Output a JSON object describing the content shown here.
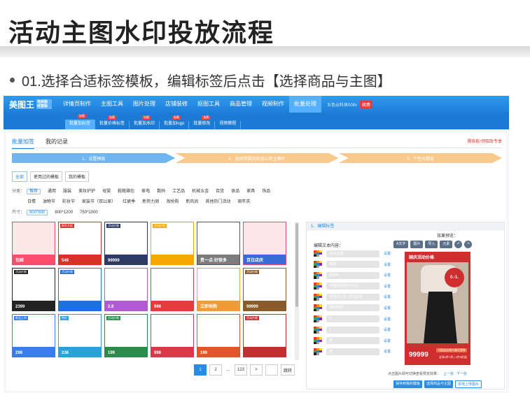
{
  "slide": {
    "title": "活动主图水印投放流程",
    "bullet": "01.选择合适标签模板，编辑标签后点击【选择商品与主图】"
  },
  "app": {
    "logo": "美图王",
    "logo_sub": "电商版 经营版",
    "nav": [
      "详情页制作",
      "主图工具",
      "图片处理",
      "店铺装修",
      "抠图工具",
      "商品管理",
      "视频制作",
      "批量处理"
    ],
    "vip_text": "五色云料体008v",
    "vip_button": "续费",
    "subnav": [
      {
        "label": "批量加标签",
        "tag": "加载"
      },
      {
        "label": "批量价格标签",
        "tag": "加载"
      },
      {
        "label": "批量加水印",
        "tag": "加载"
      },
      {
        "label": "批量加logo",
        "tag": "加载"
      },
      {
        "label": "批量修改",
        "tag": "加载"
      },
      {
        "label": "视频教程",
        "tag": ""
      }
    ]
  },
  "tabs": {
    "t1": "批量加签",
    "t2": "我的记录",
    "promo": "需级能/领取政专享"
  },
  "steps": [
    "1、设置模板",
    "2、选择需要的商品以及主图片",
    "3、个性化精选"
  ],
  "filters": [
    "全部",
    "使用过的模板",
    "我的模板"
  ],
  "cats": {
    "label": "分类：",
    "row1": [
      "推荐",
      "通用",
      "服装",
      "美妆护护",
      "母婴",
      "鞋靴箱包",
      "家电",
      "数码",
      "工艺品",
      "机械五金",
      "百货",
      "食品",
      "家具",
      "饰品"
    ],
    "row2": [
      "日情",
      "油物节",
      "彩妆节",
      "家装节（双11家）",
      "红更季",
      "新势力周",
      "淘抢购",
      "新风尚",
      "其他热门活动",
      "周年庆"
    ],
    "size_label": "尺寸：",
    "sizes": [
      "800*800",
      "800*1200",
      "750*1000"
    ]
  },
  "templates": [
    {
      "top": "",
      "price": "包邮",
      "bg": "#fde6e8",
      "bar": "#ff4d6d",
      "tc": "#e34b6f"
    },
    {
      "top": "新年大促",
      "price": "549",
      "bg": "#fff",
      "bar": "#d9302c",
      "tc": "#d9302c"
    },
    {
      "top": "活动价格",
      "price": "99999",
      "bg": "#fff",
      "bar": "#2b3a67",
      "tc": "#2b3a67"
    },
    {
      "top": "活动价格",
      "price": "",
      "bg": "#fff",
      "bar": "#f7a800",
      "tc": "#f7a800"
    },
    {
      "top": "",
      "price": "贵一点·好很多",
      "bg": "#fff",
      "bar": "#7c7c7c",
      "tc": "#555"
    },
    {
      "top": "",
      "price": "百日店庆",
      "bg": "#fbe5e8",
      "bar": "#3a6bd4",
      "tc": "#e94b6a"
    },
    {
      "top": "活动价格",
      "price": "2399",
      "bg": "#fff",
      "bar": "#222",
      "tc": "#222"
    },
    {
      "top": "活动价格",
      "price": "",
      "bg": "#fff",
      "bar": "#1e6fe0",
      "tc": "#1e6fe0"
    },
    {
      "top": "",
      "price": "2.8",
      "bg": "#fff",
      "bar": "#b25ad4",
      "tc": "#b25ad4"
    },
    {
      "top": "",
      "price": "998",
      "bg": "#fff",
      "bar": "#e43c3c",
      "tc": "#e43c3c"
    },
    {
      "top": "",
      "price": "立即抢购",
      "bg": "#fff",
      "bar": "#f19a3a",
      "tc": "#f19a3a"
    },
    {
      "top": "活动价格",
      "price": "99999",
      "bg": "#fff",
      "bar": "#8a5a2b",
      "tc": "#8a5a2b"
    },
    {
      "top": "新品上市",
      "price": "298",
      "bg": "#fff",
      "bar": "#3a7de8",
      "tc": "#3a7de8"
    },
    {
      "top": "特价",
      "price": "238",
      "bg": "#fff",
      "bar": "#2aa1d8",
      "tc": "#2aa1d8"
    },
    {
      "top": "活动价格",
      "price": "199",
      "bg": "#fff",
      "bar": "#2c8a4a",
      "tc": "#2c8a4a"
    },
    {
      "top": "",
      "price": "998",
      "bg": "#fff",
      "bar": "#d83a4a",
      "tc": "#d83a4a"
    },
    {
      "top": "",
      "price": "199",
      "bg": "#fff",
      "bar": "#e0552a",
      "tc": "#e0552a"
    },
    {
      "top": "活动价格",
      "price": "",
      "bg": "#fff",
      "bar": "#c23030",
      "tc": "#c23030"
    }
  ],
  "pager": [
    "1",
    "2",
    "...",
    "123",
    ">",
    "",
    "跳转"
  ],
  "editor": {
    "header": "1、编辑标签",
    "text_label": "编辑文本内容：",
    "preview_label": "效果预览：",
    "tools": [
      "A文字",
      "图片",
      "导入",
      "元素"
    ],
    "fields": [
      "活动主图",
      "包邮",
      "99999",
      "可提前抢购2件折后",
      "全场1件7折 2件5折起",
      "限时抢购",
      "0",
      "1",
      "送",
      "送"
    ],
    "set_label": "设置",
    "preview": {
      "top": "国庆活动价格",
      "badge": "0.-1.",
      "price": "99999",
      "ribbon1": "可盘加店铺大额优惠券",
      "ribbon2": "全场1件7折 | 2件5折起"
    },
    "hint": "点击图片即可切换查看预览效果：",
    "prev": "上一张",
    "next": "下一张",
    "actions": [
      "保存到我的模板",
      "选择商品与主图",
      "本地上传图片"
    ]
  }
}
